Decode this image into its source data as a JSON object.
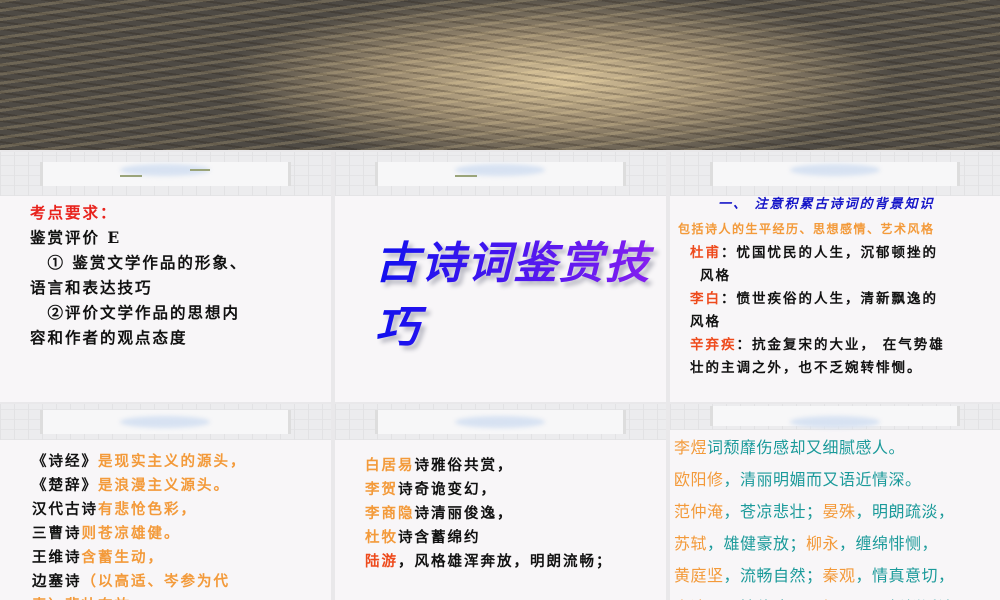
{
  "slide1": {
    "heading": "考点要求：",
    "lines": [
      "鉴赏评价 E",
      "　① 鉴赏文学作品的形象、",
      "语言和表达技巧",
      "　②评价文学作品的思想内",
      "容和作者的观点态度"
    ]
  },
  "slide2": {
    "title": "古诗词鉴赏技巧"
  },
  "slide3": {
    "heading": "一、 注意积累古诗词的背景知识",
    "sub": "包括诗人的生平经历、思想感情、艺术风格",
    "items": [
      {
        "name": "杜甫",
        "text": "：忧国忧民的人生，沉郁顿挫的",
        "cont": "风格"
      },
      {
        "name": "李白",
        "text": "：愤世疾俗的人生，清新飘逸的",
        "cont": "风格"
      },
      {
        "name": "辛弃疾",
        "text": "：抗金复宋的大业， 在气势雄",
        "cont": "壮的主调之外，也不乏婉转悱恻。"
      }
    ]
  },
  "slide4": {
    "items": [
      {
        "a": "《诗经》",
        "b": "是现实主义的源头，"
      },
      {
        "a": "《楚辞》",
        "b": "是浪漫主义源头。"
      },
      {
        "a": "汉代古诗",
        "b": "有悲怆色彩，"
      },
      {
        "a": "三曹诗",
        "b": "则苍凉雄健。"
      },
      {
        "a": "王维诗",
        "b": "含蓄生动，"
      },
      {
        "a": "边塞诗",
        "b": "（以高适、岑参为代"
      },
      {
        "a": "",
        "b": "表）悲壮奔放"
      }
    ]
  },
  "slide5": {
    "items": [
      {
        "a": "白居易",
        "b": "诗雅俗共赏，"
      },
      {
        "a": "李贺",
        "b": "诗奇诡变幻，"
      },
      {
        "a": "李商隐",
        "b": "诗清丽俊逸，"
      },
      {
        "a": "杜牧",
        "b": "诗含蓄绵约"
      },
      {
        "a": "陆游",
        "b": "，风格雄浑奔放，明朗流畅；"
      }
    ]
  },
  "slide6": {
    "items": [
      [
        {
          "o": "李煜"
        },
        {
          "t": "词颓靡伤感却又细腻感人。"
        }
      ],
      [
        {
          "o": "欧阳修"
        },
        {
          "t": "，清丽明媚而又语近情深。"
        }
      ],
      [
        {
          "o": "范仲淹"
        },
        {
          "t": "，苍凉悲壮；"
        },
        {
          "o": "晏殊"
        },
        {
          "t": "，明朗疏淡，"
        }
      ],
      [
        {
          "o": "苏轼"
        },
        {
          "t": "，雄健豪放；"
        },
        {
          "o": "柳永"
        },
        {
          "t": "，缠绵悱恻，"
        }
      ],
      [
        {
          "o": "黄庭坚"
        },
        {
          "t": "，流畅自然；"
        },
        {
          "o": "秦观"
        },
        {
          "t": "，情真意切，"
        }
      ],
      [
        {
          "o": "李清照"
        },
        {
          "t": "，婉约凄切；"
        },
        {
          "o": "杨万里"
        },
        {
          "t": "，新鲜活泼"
        }
      ]
    ]
  }
}
